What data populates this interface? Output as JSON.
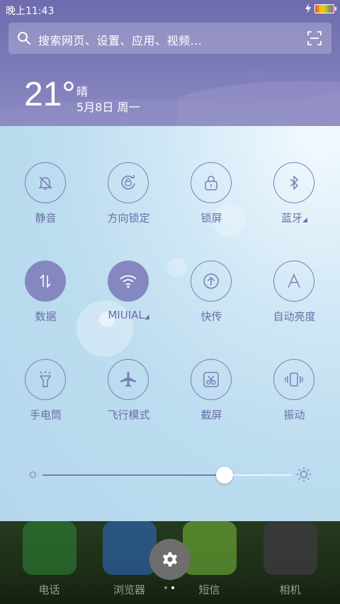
{
  "status": {
    "time": "晚上11:43",
    "charging_icon": "lightning-icon",
    "battery_icon": "battery-icon"
  },
  "search": {
    "placeholder": "搜索网页、设置、应用、视频...",
    "search_icon": "search-icon",
    "scan_icon": "scan-icon"
  },
  "weather": {
    "temperature": "21°",
    "condition": "晴",
    "date": "5月8日 周一"
  },
  "toggles": [
    {
      "label": "静音",
      "icon": "bell-slash-icon",
      "active": false
    },
    {
      "label": "方向锁定",
      "icon": "rotation-lock-icon",
      "active": false
    },
    {
      "label": "锁屏",
      "icon": "lock-icon",
      "active": false
    },
    {
      "label": "蓝牙",
      "icon": "bluetooth-icon",
      "active": false,
      "has_more": true
    },
    {
      "label": "数据",
      "icon": "data-arrows-icon",
      "active": true
    },
    {
      "label": "MIUIAL",
      "icon": "wifi-icon",
      "active": true,
      "has_more": true
    },
    {
      "label": "快传",
      "icon": "upload-icon",
      "active": false
    },
    {
      "label": "自动亮度",
      "icon": "letter-a-icon",
      "active": false
    },
    {
      "label": "手电筒",
      "icon": "flashlight-icon",
      "active": false
    },
    {
      "label": "飞行模式",
      "icon": "airplane-icon",
      "active": false
    },
    {
      "label": "截屏",
      "icon": "screenshot-icon",
      "active": false
    },
    {
      "label": "振动",
      "icon": "vibrate-icon",
      "active": false
    }
  ],
  "brightness": {
    "level": 0.73,
    "min_icon": "dim-dot-icon",
    "max_icon": "sun-icon"
  },
  "dock": {
    "apps": [
      {
        "label": "电话",
        "icon": "phone-icon",
        "color": "#2e8b3a"
      },
      {
        "label": "浏览器",
        "icon": "browser-icon",
        "color": "#2f6fd0"
      },
      {
        "label": "短信",
        "icon": "message-icon",
        "color": "#7bbf3a"
      },
      {
        "label": "相机",
        "icon": "camera-icon",
        "color": "#3a3a3a"
      }
    ],
    "settings_icon": "gear-icon",
    "page_count": 2,
    "current_page": 2
  },
  "colors": {
    "accent": "#8587c0",
    "header": "#7a78b6"
  }
}
